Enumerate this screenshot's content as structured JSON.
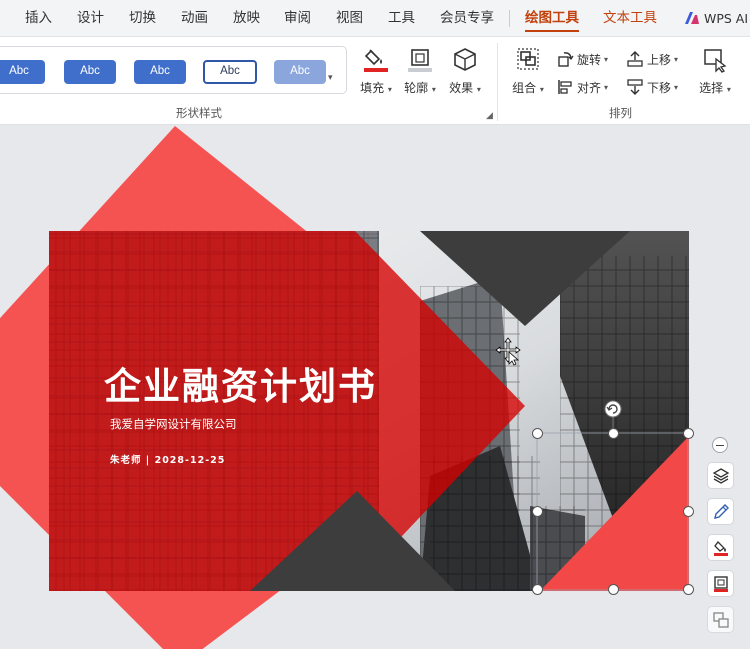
{
  "menu": {
    "items": [
      "插入",
      "设计",
      "切换",
      "动画",
      "放映",
      "审阅",
      "视图",
      "工具",
      "会员专享"
    ],
    "drawing_tools": "绘图工具",
    "text_tools": "文本工具",
    "ai": "WPS AI"
  },
  "ribbon": {
    "shape_styles": {
      "swatches": [
        "Abc",
        "Abc",
        "Abc",
        "Abc",
        "Abc"
      ],
      "group_label": "形状样式"
    },
    "fill": "填充",
    "outline": "轮廓",
    "effect": "效果",
    "arrange": {
      "group": "组合",
      "rotate": "旋转",
      "align": "对齐",
      "bring_forward": "上移",
      "send_backward": "下移",
      "select": "选择",
      "group_label": "排列"
    }
  },
  "slide": {
    "title": "企业融资计划书",
    "company": "我爱自学网设计有限公司",
    "author_line": "朱老师  |  2028-12-25"
  },
  "colors": {
    "accent_red": "#f04a4a",
    "dark_gray": "#3d3d3d",
    "active_tab": "#c2410c",
    "swatch_blue": "#3f6fcb"
  }
}
